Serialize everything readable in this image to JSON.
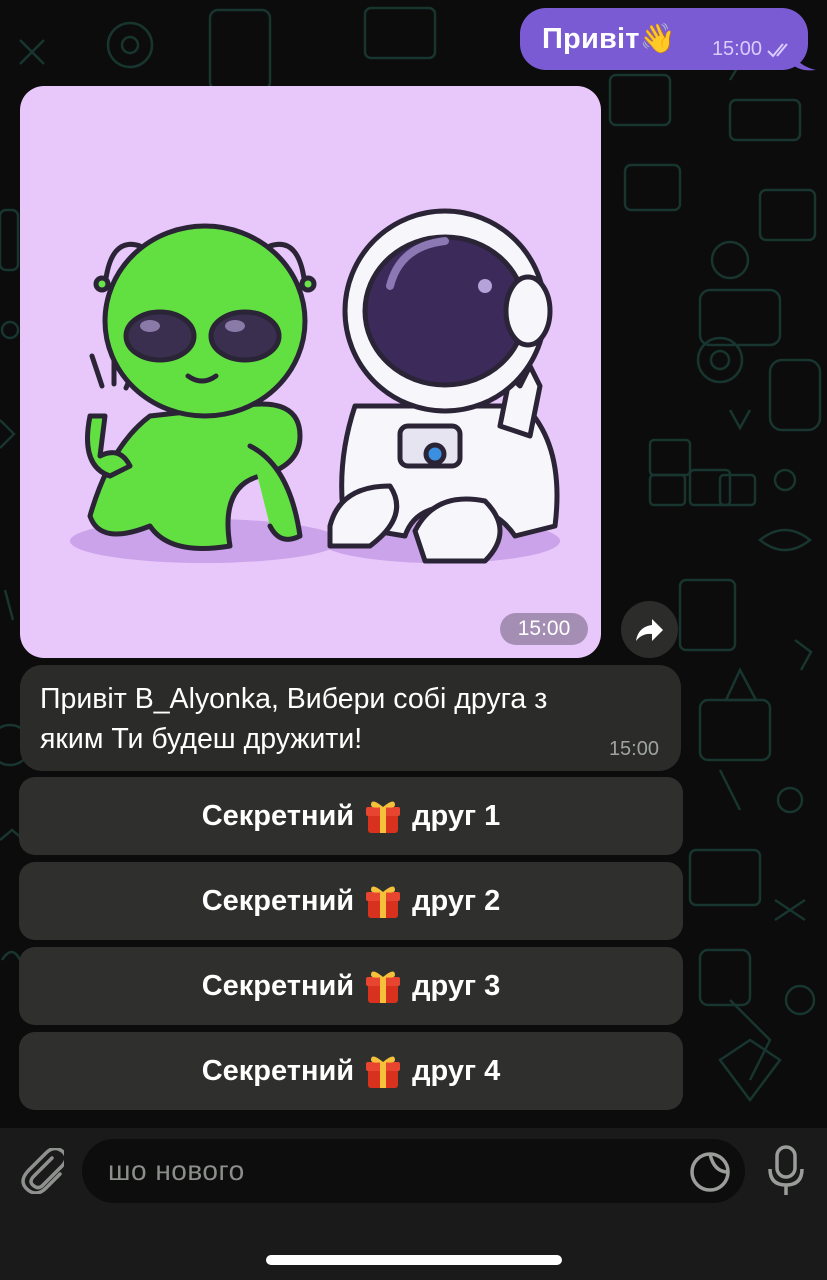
{
  "outgoing": {
    "text": "Привіт👋",
    "time": "15:00",
    "status": "read"
  },
  "photo": {
    "time": "15:00"
  },
  "incoming": {
    "line1": "Привіт B_Alyonka, Вибери собі друга з",
    "line2": "яким Ти будеш дружити!",
    "time": "15:00"
  },
  "keyboard": [
    {
      "pre": "Секретний",
      "post": "друг 1"
    },
    {
      "pre": "Секретний",
      "post": "друг 2"
    },
    {
      "pre": "Секретний",
      "post": "друг 3"
    },
    {
      "pre": "Секретний",
      "post": "друг 4"
    }
  ],
  "input": {
    "placeholder": "шо нового"
  },
  "colors": {
    "outgoing_bubble": "#7b5bd3",
    "incoming_bubble": "#2b2c2a",
    "keyboard_button": "#2f302d",
    "photo_bg": "#e8c8fb"
  },
  "icons": [
    "forward-arrow-icon",
    "read-checkmarks-icon",
    "attach-icon",
    "sticker-icon",
    "microphone-icon",
    "gift-icon"
  ]
}
